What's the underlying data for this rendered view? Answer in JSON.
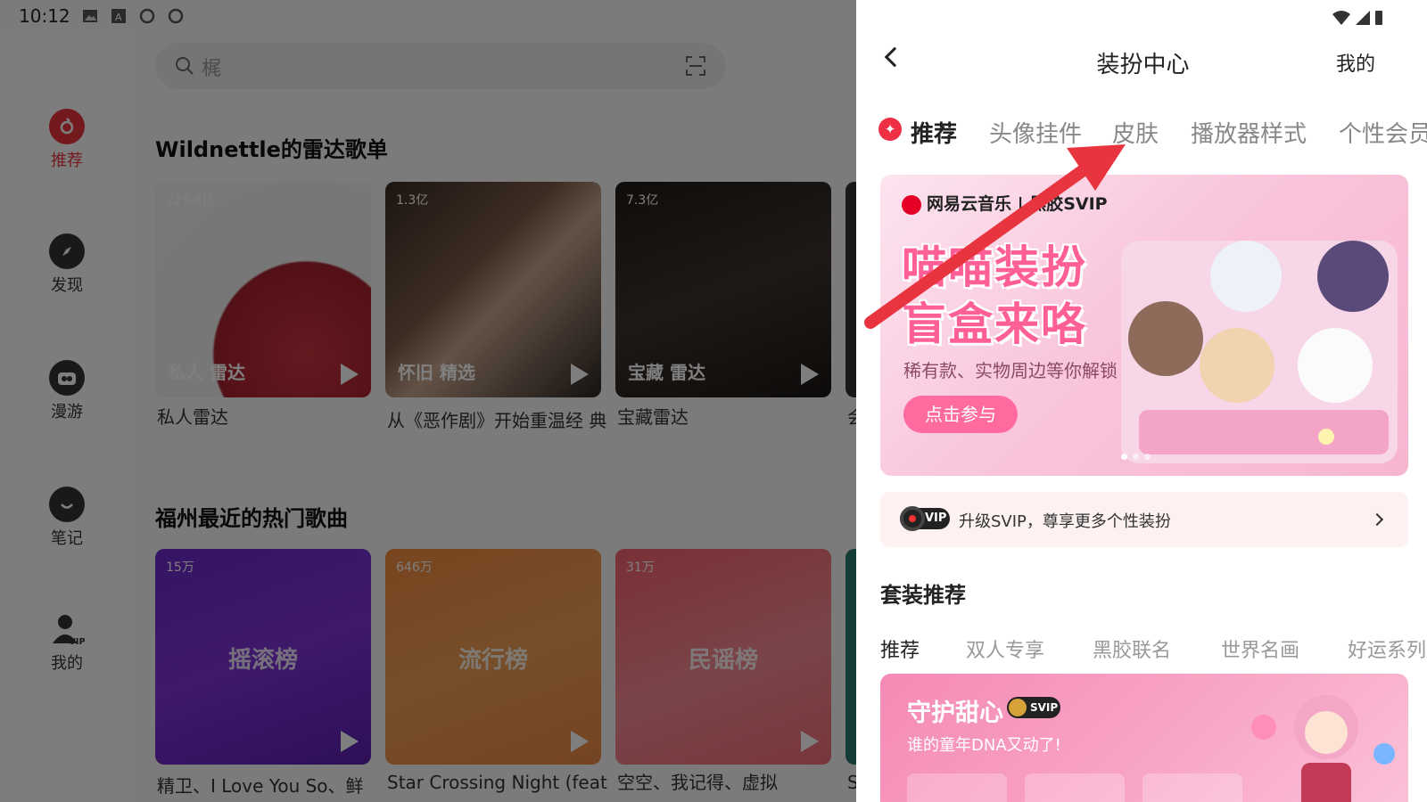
{
  "status": {
    "time": "10:12"
  },
  "search": {
    "placeholder": "梶"
  },
  "sidebar": {
    "items": [
      {
        "label": "推荐",
        "icon": "netease-logo-icon"
      },
      {
        "label": "发现",
        "icon": "compass-icon"
      },
      {
        "label": "漫游",
        "icon": "radio-icon"
      },
      {
        "label": "笔记",
        "icon": "note-icon"
      },
      {
        "label": "我的",
        "icon": "user-vip-icon"
      }
    ]
  },
  "section1": {
    "title": "Wildnettle的雷达歌单",
    "cards": [
      {
        "play_count": "229.8亿",
        "cover_text": "私人 雷达",
        "caption": "私人雷达"
      },
      {
        "play_count": "1.3亿",
        "cover_text": "怀旧 精选",
        "caption": "从《恶作剧》开始重温经 典"
      },
      {
        "play_count": "7.3亿",
        "cover_text": "宝藏 雷达",
        "caption": "宝藏雷达"
      },
      {
        "caption": "会"
      }
    ]
  },
  "section2": {
    "title": "福州最近的热门歌曲",
    "cards": [
      {
        "play_count": "15万",
        "center_title": "摇滚榜",
        "caption": "精卫、I Love You So、鲜"
      },
      {
        "play_count": "646万",
        "center_title": "流行榜",
        "caption": "Star Crossing Night (feat."
      },
      {
        "play_count": "31万",
        "center_title": "民谣榜",
        "caption": "空空、我记得、虚拟"
      },
      {
        "caption": "S"
      }
    ]
  },
  "panel": {
    "title": "装扮中心",
    "right_link": "我的",
    "tabs": [
      "推荐",
      "头像挂件",
      "皮肤",
      "播放器样式",
      "个性会员"
    ],
    "banner": {
      "brand": "网易云音乐",
      "brand_svip": "黑胶SVIP",
      "headline1": "喵喵装扮",
      "headline2": "盲盒来咯",
      "subtitle": "稀有款、实物周边等你解锁",
      "button": "点击参与"
    },
    "svip_bar": {
      "badge": "VIP",
      "text": "升级SVIP，尊享更多个性装扮"
    },
    "suit_section": {
      "title": "套装推荐",
      "tabs": [
        "推荐",
        "双人专享",
        "黑胶联名",
        "世界名画",
        "好运系列"
      ],
      "card": {
        "name": "守护甜心",
        "badge": "SVIP",
        "subtitle": "谁的童年DNA又动了!"
      }
    }
  },
  "colors": {
    "accent": "#e8343e",
    "banner_pink": "#ff5f97",
    "arrow": "#e8343e"
  }
}
